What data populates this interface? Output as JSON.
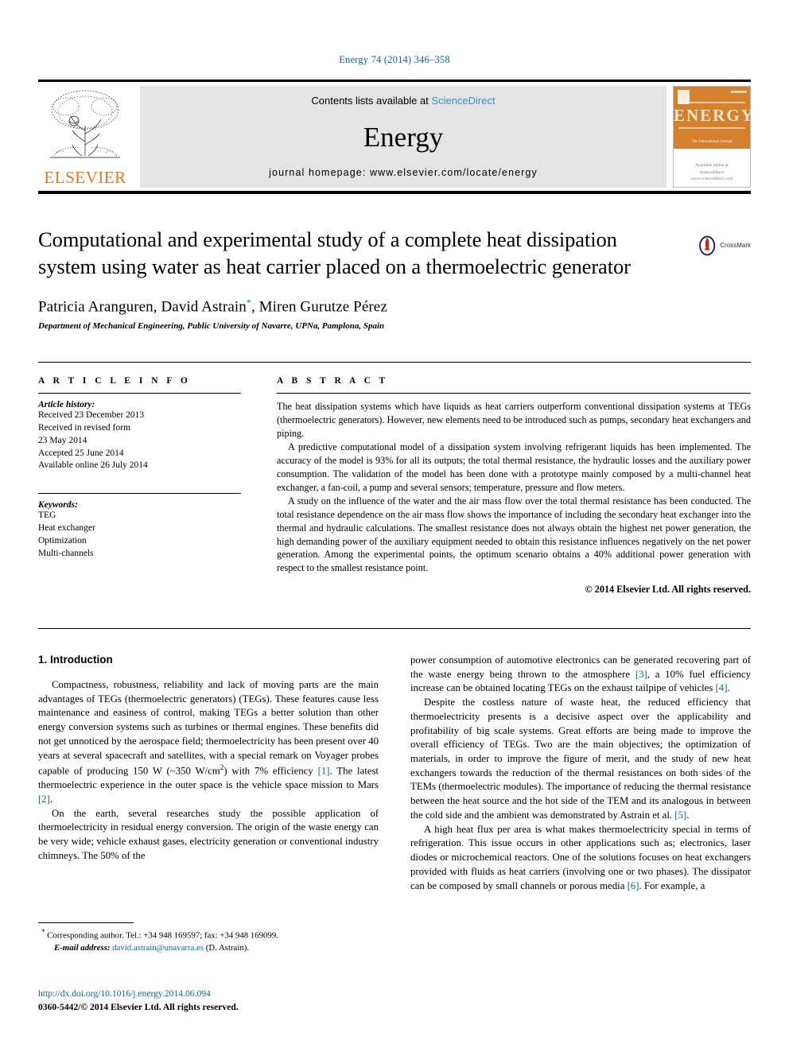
{
  "running_head": "Energy 74 (2014) 346–358",
  "masthead": {
    "contents_prefix": "Contents lists available at ",
    "sciencedirect": "ScienceDirect",
    "journal_title": "Energy",
    "homepage": "journal homepage: www.elsevier.com/locate/energy",
    "publisher_wordmark": "ELSEVIER",
    "cover": {
      "title": "ENERGY",
      "subtitle": "The International Journal",
      "footer_line1": "Available online at",
      "footer_line2": "ScienceDirect",
      "footer_line3": "www.sciencedirect.com"
    }
  },
  "article": {
    "title": "Computational and experimental study of a complete heat dissipation system using water as heat carrier placed on a thermoelectric generator",
    "authors": "Patricia Aranguren, David Astrain",
    "authors_tail": ", Miren Gurutze Pérez",
    "corresponding_marker": "*",
    "affiliation": "Department of Mechanical Engineering, Public University of Navarre, UPNa, Pamplona, Spain",
    "crossmark_label": "CrossMark"
  },
  "article_info": {
    "heading": "A R T I C L E   I N F O",
    "history_label": "Article history:",
    "history": [
      "Received 23 December 2013",
      "Received in revised form",
      "23 May 2014",
      "Accepted 25 June 2014",
      "Available online 26 July 2014"
    ],
    "keywords_label": "Keywords:",
    "keywords": [
      "TEG",
      "Heat exchanger",
      "Optimization",
      "Multi-channels"
    ]
  },
  "abstract": {
    "heading": "A B S T R A C T",
    "paragraphs": [
      "The heat dissipation systems which have liquids as heat carriers outperform conventional dissipation systems at TEGs (thermoelectric generators). However, new elements need to be introduced such as pumps, secondary heat exchangers and piping.",
      "A predictive computational model of a dissipation system involving refrigerant liquids has been implemented. The accuracy of the model is 93% for all its outputs; the total thermal resistance, the hydraulic losses and the auxiliary power consumption. The validation of the model has been done with a prototype mainly composed by a multi-channel heat exchanger, a fan-coil, a pump and several sensors; temperature, pressure and flow meters.",
      "A study on the influence of the water and the air mass flow over the total thermal resistance has been conducted. The total resistance dependence on the air mass flow shows the importance of including the secondary heat exchanger into the thermal and hydraulic calculations. The smallest resistance does not always obtain the highest net power generation, the high demanding power of the auxiliary equipment needed to obtain this resistance influences negatively on the net power generation. Among the experimental points, the optimum scenario obtains a 40% additional power generation with respect to the smallest resistance point."
    ],
    "copyright": "© 2014 Elsevier Ltd. All rights reserved."
  },
  "introduction": {
    "section_title": "1. Introduction",
    "left_paragraphs": [
      {
        "parts": [
          {
            "t": "Compactness, robustness, reliability and lack of moving parts are the main advantages of TEGs (thermoelectric generators) (TEGs). These features cause less maintenance and easiness of control, making TEGs a better solution than other energy conversion systems such as turbines or thermal engines. These benefits did not get unnoticed by the aerospace field; thermoelectricity has been present over 40 years at several spacecraft and satellites, with a special remark on Voyager probes capable of producing 150 W (~350 W/cm"
          },
          {
            "t": "2",
            "sup": true
          },
          {
            "t": ") with 7% efficiency "
          },
          {
            "t": "[1]",
            "cite": true
          },
          {
            "t": ". The latest thermoelectric experience in the outer space is the vehicle space mission to Mars "
          },
          {
            "t": "[2]",
            "cite": true
          },
          {
            "t": "."
          }
        ]
      },
      {
        "parts": [
          {
            "t": "On the earth, several researches study the possible application of thermoelectricity in residual energy conversion. The origin of the waste energy can be very wide; vehicle exhaust gases, electricity generation or conventional industry chimneys. The 50% of the"
          }
        ]
      }
    ],
    "right_paragraphs": [
      {
        "parts": [
          {
            "t": "power consumption of automotive electronics can be generated recovering part of the waste energy being thrown to the atmosphere "
          },
          {
            "t": "[3]",
            "cite": true
          },
          {
            "t": ", a 10% fuel efficiency increase can be obtained locating TEGs on the exhaust tailpipe of vehicles "
          },
          {
            "t": "[4]",
            "cite": true
          },
          {
            "t": "."
          }
        ],
        "no_indent": true
      },
      {
        "parts": [
          {
            "t": "Despite the costless nature of waste heat, the reduced efficiency that thermoelectricity presents is a decisive aspect over the applicability and profitability of big scale systems. Great efforts are being made to improve the overall efficiency of TEGs. Two are the main objectives; the optimization of materials, in order to improve the figure of merit, and the study of new heat exchangers towards the reduction of the thermal resistances on both sides of the TEMs (thermoelectric modules). The importance of reducing the thermal resistance between the heat source and the hot side of the TEM and its analogous in between the cold side and the ambient was demonstrated by Astrain et al. "
          },
          {
            "t": "[5]",
            "cite": true
          },
          {
            "t": "."
          }
        ]
      },
      {
        "parts": [
          {
            "t": "A high heat flux per area is what makes thermoelectricity special in terms of refrigeration. This issue occurs in other applications such as; electronics, laser diodes or microchemical reactors. One of the solutions focuses on heat exchangers provided with fluids as heat carriers (involving one or two phases). The dissipator can be composed by small channels or porous media "
          },
          {
            "t": "[6]",
            "cite": true
          },
          {
            "t": ". For example, a"
          }
        ]
      }
    ]
  },
  "footnotes": {
    "corresponding": "Corresponding author. Tel.: +34 948 169597; fax: +34 948 169099.",
    "email_label": "E-mail address:",
    "email": "david.astrain@unavarra.es",
    "email_suffix": " (D. Astrain)."
  },
  "footer": {
    "doi": "http://dx.doi.org/10.1016/j.energy.2014.06.094",
    "issn": "0360-5442/© 2014 Elsevier Ltd. All rights reserved."
  },
  "colors": {
    "link": "#0b6a9b",
    "sciencedirect": "#3a8fd0",
    "elsevier_orange": "#E87722",
    "masthead_grey": "#e4e4e4"
  }
}
